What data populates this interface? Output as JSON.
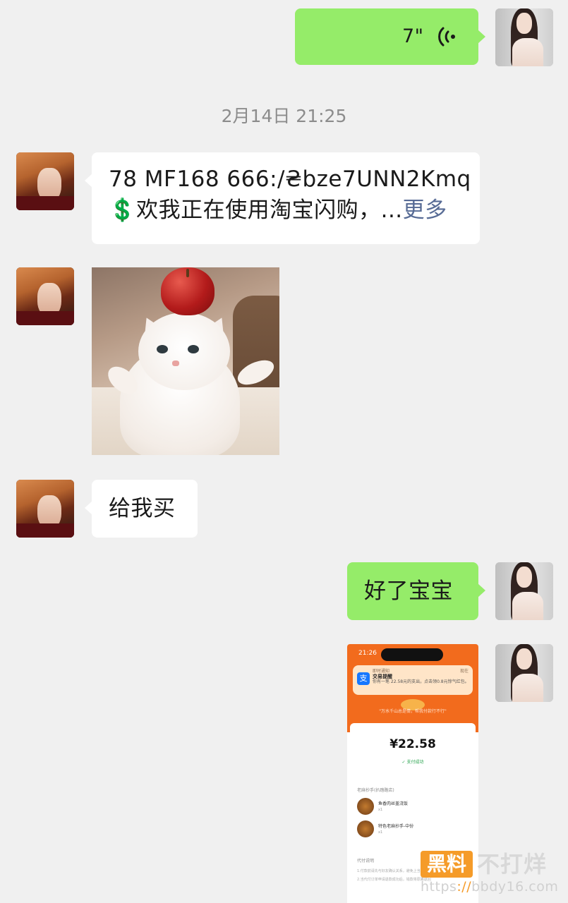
{
  "messages": {
    "voice": {
      "duration": "7\"",
      "icon": "voice-wave-icon"
    },
    "timestamp": "2月14日 21:25",
    "shared_link": {
      "line1": "78 MF168 666:/₴bze7UNN2Kmq",
      "line2": "💲欢我正在使用淘宝闪购，...",
      "more": "更多"
    },
    "reply_buy": "给我买",
    "reply_ok": "好了宝宝"
  },
  "screenshot_card": {
    "status_time": "21:26",
    "notif_app": "即时通知",
    "notif_title": "交易提醒",
    "notif_body": "你有一笔 22.58元的支出，点击领0.8元惊气红包。",
    "notif_tag": "现在",
    "notif_icon_glyph": "支",
    "slogan": "\"万水千山总是情，帮我付款行不行\"",
    "amount": "¥22.58",
    "paid_status": "支付成功",
    "section_title": "老麻抄手(扒踏路店)",
    "items": [
      {
        "name": "鱼香肉丝盖浇饭",
        "qty": "x1"
      },
      {
        "name": "特色老麻抄手-中份",
        "qty": "x1"
      }
    ],
    "section2_title": "代付说明",
    "notes": [
      "1.付款前请先与好友确认关系，避免上当受骗",
      "2.当代付订单申请退款成功后，钱款将原路退回"
    ]
  },
  "watermark": {
    "badge": "黑料",
    "text": "不打烊",
    "url_prefix": "https",
    "url_sep": "://",
    "url_rest": "bbdy16.com"
  },
  "colors": {
    "background": "#f0f0f0",
    "bubble_green": "#95ec69",
    "bubble_white": "#ffffff",
    "more_link": "#576b95",
    "app_orange": "#f26b1d"
  }
}
